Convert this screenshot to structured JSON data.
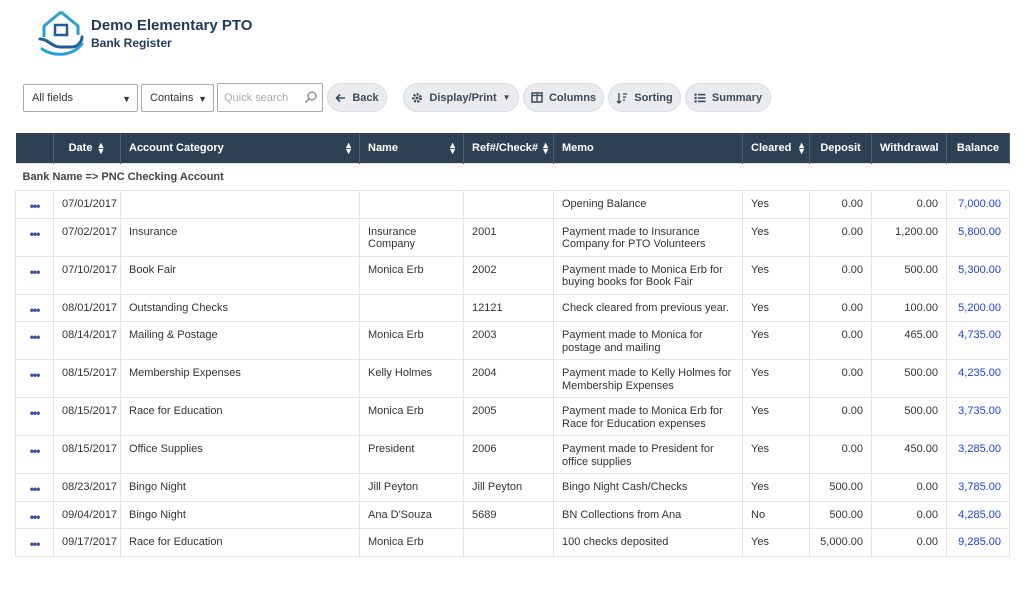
{
  "header": {
    "title": "Demo Elementary PTO",
    "subtitle": "Bank Register"
  },
  "toolbar": {
    "field_select": "All fields",
    "operator_select": "Contains",
    "search_placeholder": "Quick search",
    "back_label": "Back",
    "display_label": "Display/Print",
    "columns_label": "Columns",
    "sorting_label": "Sorting",
    "summary_label": "Summary"
  },
  "table": {
    "columns": [
      "Date",
      "Account Category",
      "Name",
      "Ref#/Check#",
      "Memo",
      "Cleared",
      "Deposit",
      "Withdrawal",
      "Balance"
    ],
    "group_label": "Bank Name => PNC Checking Account",
    "rows": [
      {
        "date": "07/01/2017",
        "category": "",
        "name": "",
        "ref": "",
        "memo": "Opening Balance",
        "cleared": "Yes",
        "deposit": "0.00",
        "withdrawal": "0.00",
        "balance": "7,000.00"
      },
      {
        "date": "07/02/2017",
        "category": "Insurance",
        "name": "Insurance Company",
        "ref": "2001",
        "memo": "Payment made to Insurance Company for PTO Volunteers",
        "cleared": "Yes",
        "deposit": "0.00",
        "withdrawal": "1,200.00",
        "balance": "5,800.00"
      },
      {
        "date": "07/10/2017",
        "category": "Book Fair",
        "name": "Monica Erb",
        "ref": "2002",
        "memo": "Payment made to Monica Erb for buying books for Book Fair",
        "cleared": "Yes",
        "deposit": "0.00",
        "withdrawal": "500.00",
        "balance": "5,300.00"
      },
      {
        "date": "08/01/2017",
        "category": "Outstanding Checks",
        "name": "",
        "ref": "12121",
        "memo": "Check cleared from previous year.",
        "cleared": "Yes",
        "deposit": "0.00",
        "withdrawal": "100.00",
        "balance": "5,200.00"
      },
      {
        "date": "08/14/2017",
        "category": "Mailing & Postage",
        "name": "Monica Erb",
        "ref": "2003",
        "memo": "Payment made to Monica for postage and mailing",
        "cleared": "Yes",
        "deposit": "0.00",
        "withdrawal": "465.00",
        "balance": "4,735.00"
      },
      {
        "date": "08/15/2017",
        "category": "Membership Expenses",
        "name": "Kelly Holmes",
        "ref": "2004",
        "memo": "Payment made to Kelly Holmes for Membership Expenses",
        "cleared": "Yes",
        "deposit": "0.00",
        "withdrawal": "500.00",
        "balance": "4,235.00"
      },
      {
        "date": "08/15/2017",
        "category": "Race for Education",
        "name": "Monica Erb",
        "ref": "2005",
        "memo": "Payment made to Monica Erb for Race for Education expenses",
        "cleared": "Yes",
        "deposit": "0.00",
        "withdrawal": "500.00",
        "balance": "3,735.00"
      },
      {
        "date": "08/15/2017",
        "category": "Office Supplies",
        "name": "President",
        "ref": "2006",
        "memo": "Payment made to President for office supplies",
        "cleared": "Yes",
        "deposit": "0.00",
        "withdrawal": "450.00",
        "balance": "3,285.00"
      },
      {
        "date": "08/23/2017",
        "category": "Bingo Night",
        "name": "Jill Peyton",
        "ref": "Jill Peyton",
        "memo": "Bingo Night Cash/Checks",
        "cleared": "Yes",
        "deposit": "500.00",
        "withdrawal": "0.00",
        "balance": "3,785.00"
      },
      {
        "date": "09/04/2017",
        "category": "Bingo Night",
        "name": "Ana D'Souza",
        "ref": "5689",
        "memo": "BN Collections from Ana",
        "cleared": "No",
        "deposit": "500.00",
        "withdrawal": "0.00",
        "balance": "4,285.00"
      },
      {
        "date": "09/17/2017",
        "category": "Race for Education",
        "name": "Monica Erb",
        "ref": "",
        "memo": "100 checks deposited",
        "cleared": "Yes",
        "deposit": "5,000.00",
        "withdrawal": "0.00",
        "balance": "9,285.00"
      }
    ]
  },
  "colors": {
    "header_bg": "#2e4153",
    "balance_text": "#1c3fe0",
    "title_text": "#1f3a5c",
    "button_bg": "#e9ebee"
  },
  "icons": [
    "house-hands-logo-icon",
    "magnifier-icon",
    "arrow-left-icon",
    "gear-icon",
    "columns-icon",
    "sort-icon",
    "list-icon",
    "row-menu-icon"
  ]
}
